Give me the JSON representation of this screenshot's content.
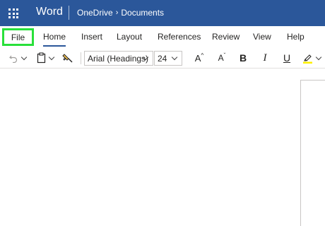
{
  "titlebar": {
    "app_name": "Word",
    "breadcrumb_parent": "OneDrive",
    "breadcrumb_separator": "›",
    "breadcrumb_current": "Documents",
    "background": "#2b579a"
  },
  "ribbon_tabs": {
    "file": "File",
    "home": "Home",
    "insert": "Insert",
    "layout": "Layout",
    "references": "References",
    "review": "Review",
    "view": "View",
    "help": "Help",
    "active": "Home",
    "highlight_color": "#29e03a"
  },
  "toolbar": {
    "font_name": "Arial (Headings)",
    "font_size": "24",
    "grow_font_label": "A",
    "shrink_font_label": "A",
    "bold_label": "B",
    "italic_label": "I",
    "underline_label": "U",
    "icons": [
      "undo-icon",
      "paste-icon",
      "format-painter-icon",
      "highlighter-icon"
    ]
  }
}
